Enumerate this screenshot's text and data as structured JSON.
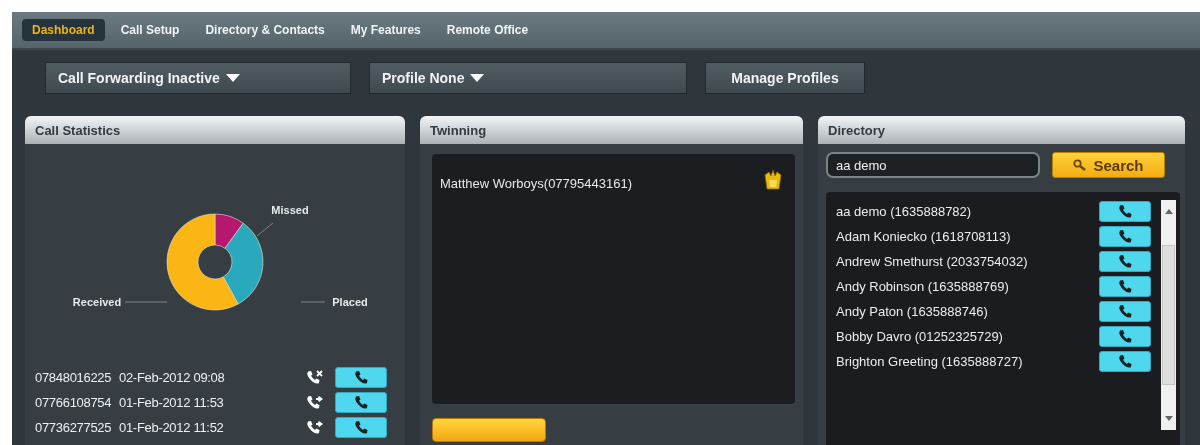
{
  "nav": {
    "tabs": [
      {
        "label": "Dashboard",
        "selected": true
      },
      {
        "label": "Call Setup",
        "selected": false
      },
      {
        "label": "Directory & Contacts",
        "selected": false
      },
      {
        "label": "My Features",
        "selected": false
      },
      {
        "label": "Remote Office",
        "selected": false
      }
    ]
  },
  "toolbar": {
    "buttons": [
      {
        "label": "Call Forwarding Inactive",
        "kind": "dropdown"
      },
      {
        "label": "Profile None",
        "kind": "dropdown"
      },
      {
        "label": "Manage Profiles",
        "kind": "plain"
      }
    ]
  },
  "call_statistics": {
    "title": "Call Statistics",
    "chart": {
      "slices": [
        {
          "label": "Missed",
          "color": "#b5186f"
        },
        {
          "label": "Placed",
          "color": "#2aa9bd"
        },
        {
          "label": "Received",
          "color": "#fbb615"
        }
      ]
    },
    "calls": [
      {
        "number": "07848016225",
        "time": "02-Feb-2012 09:08",
        "kind": "missed"
      },
      {
        "number": "07766108754",
        "time": "01-Feb-2012 11:53",
        "kind": "placed"
      },
      {
        "number": "07736277525",
        "time": "01-Feb-2012 11:52",
        "kind": "placed"
      }
    ]
  },
  "twinning": {
    "title": "Twinning",
    "entries": [
      "Matthew Worboys(07795443161)"
    ]
  },
  "directory": {
    "title": "Directory",
    "search": {
      "value": "aa demo"
    },
    "search_button": "Search",
    "contacts": [
      "aa demo (1635888782)",
      "Adam Koniecko (1618708113)",
      "Andrew Smethurst (2033754032)",
      "Andy Robinson (1635888769)",
      "Andy Paton (1635888746)",
      "Bobby Davro (01252325729)",
      "Brighton Greeting (1635888727)"
    ]
  }
}
